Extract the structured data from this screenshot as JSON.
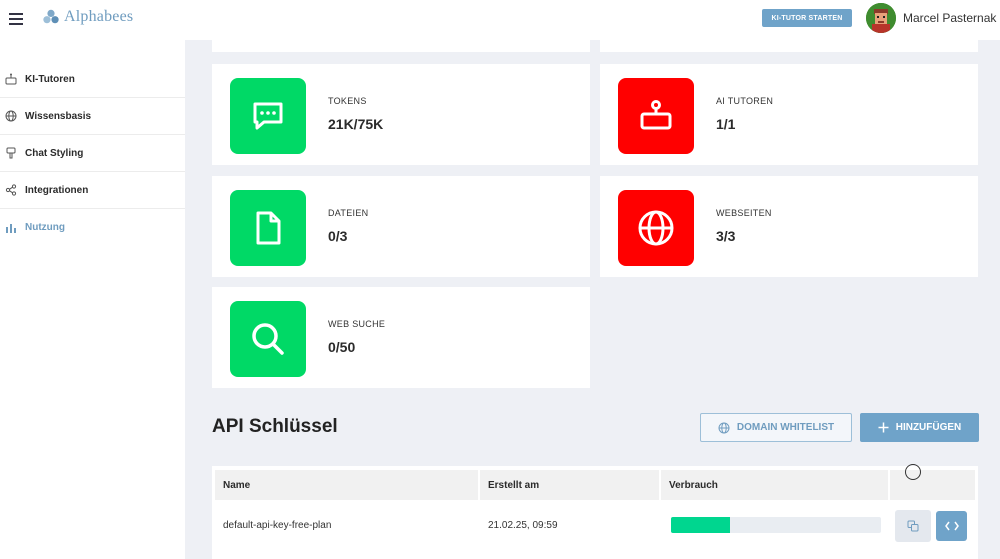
{
  "header": {
    "logo_text": "Alphabees",
    "start_button": "KI-TUTOR STARTEN",
    "user_name": "Marcel Pasternak"
  },
  "sidebar": {
    "items": [
      {
        "label": "KI-Tutoren",
        "icon": "robot-icon"
      },
      {
        "label": "Wissensbasis",
        "icon": "globe-icon"
      },
      {
        "label": "Chat Styling",
        "icon": "brush-icon"
      },
      {
        "label": "Integrationen",
        "icon": "share-icon"
      },
      {
        "label": "Nutzung",
        "icon": "bar-chart-icon",
        "active": true
      }
    ]
  },
  "stats": {
    "tokens": {
      "label": "TOKENS",
      "value": "21K/75K",
      "icon": "chat-icon"
    },
    "ai_tutors": {
      "label": "AI TUTOREN",
      "value": "1/1",
      "icon": "robot-icon"
    },
    "files": {
      "label": "DATEIEN",
      "value": "0/3",
      "icon": "file-icon"
    },
    "websites": {
      "label": "WEBSEITEN",
      "value": "3/3",
      "icon": "globe-icon"
    },
    "web_search": {
      "label": "WEB SUCHE",
      "value": "0/50",
      "icon": "search-icon"
    }
  },
  "api": {
    "title": "API Schlüssel",
    "whitelist_button": "DOMAIN WHITELIST",
    "add_button": "HINZUFÜGEN",
    "columns": [
      "Name",
      "Erstellt am",
      "Verbrauch"
    ],
    "rows": [
      {
        "name": "default-api-key-free-plan",
        "created": "21.02.25, 09:59",
        "usage_fraction": 0.28
      }
    ]
  },
  "colors": {
    "accent": "#6fa3c9",
    "ok": "#00d966",
    "limit": "#ff0000",
    "progress": "#00d68f",
    "background": "#eef0f5"
  }
}
